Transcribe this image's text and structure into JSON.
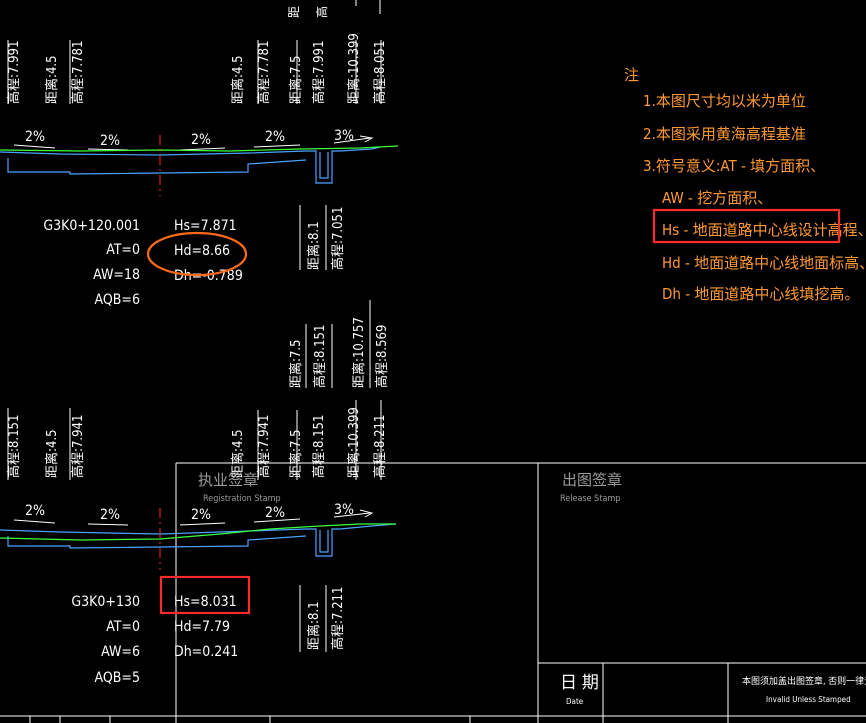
{
  "colors": {
    "background": "#000000",
    "linework": "#ffffff",
    "ground_line": "#3cff3c",
    "design_line": "#4aa3ff",
    "note_text": "#ff9933",
    "highlight_box": "#ff2a2a",
    "highlight_ellipse": "#ff6a1a"
  },
  "notes": {
    "heading": "注",
    "line1": "1.本图尺寸均以米为单位",
    "line2": "2.本图采用黄海高程基准",
    "line3": "3.符号意义:AT - 填方面积、",
    "line4": "AW - 挖方面积、",
    "line5": "Hs - 地面道路中心线设计高程、",
    "line6": "Hd - 地面道路中心线地面标高、",
    "line7": "Dh - 地面道路中心线填挖高。"
  },
  "section1": {
    "station": "G3K0+120.001",
    "at": "AT=0",
    "aw": "AW=18",
    "aqb": "AQB=6",
    "hs": "Hs=7.871",
    "hd": "Hd=8.66",
    "dh": "Dh=-0.789",
    "grades": [
      "2%",
      "2%",
      "2%",
      "2%",
      "3%"
    ],
    "dims": {
      "left_a": "高程:7.991",
      "left_b": "距离:4.5",
      "left_c": "高程:7.781",
      "mid_a": "距离:4.5",
      "mid_b": "高程:7.781",
      "mid_c": "距离:7.5",
      "mid_d": "高程:7.991",
      "right_a": "距离:10.399",
      "right_b": "高程:8.051",
      "bot_a": "距离:8.1",
      "bot_b": "高程:7.051"
    }
  },
  "section2": {
    "station": "G3K0+130",
    "at": "AT=0",
    "aw": "AW=6",
    "aqb": "AQB=5",
    "hs": "Hs=8.031",
    "hd": "Hd=7.79",
    "dh": "Dh=0.241",
    "grades": [
      "2%",
      "2%",
      "2%",
      "2%",
      "3%"
    ],
    "dims": {
      "top_a": "距离:7.5",
      "top_b": "高程:8.151",
      "top_c": "距离:10.757",
      "top_d": "高程:8.569",
      "left_a": "高程:8.151",
      "left_b": "距离:4.5",
      "left_c": "高程:7.941",
      "mid_a": "距离:4.5",
      "mid_b": "高程:7.941",
      "mid_c": "距离:7.5",
      "mid_d": "高程:8.151",
      "right_a": "距离:10.399",
      "right_b": "高程:8.211",
      "bot_a": "距离:8.1",
      "bot_b": "高程:7.211"
    }
  },
  "title_block": {
    "registration_cn": "执业签章",
    "registration_en": "Registration Stamp",
    "release_cn": "出图签章",
    "release_en": "Release Stamp",
    "date_cn": "日 期",
    "date_en": "Date",
    "invalid_cn": "本图须加盖出图签章, 否则一律无",
    "invalid_en": "Invalid Unless Stamped"
  }
}
